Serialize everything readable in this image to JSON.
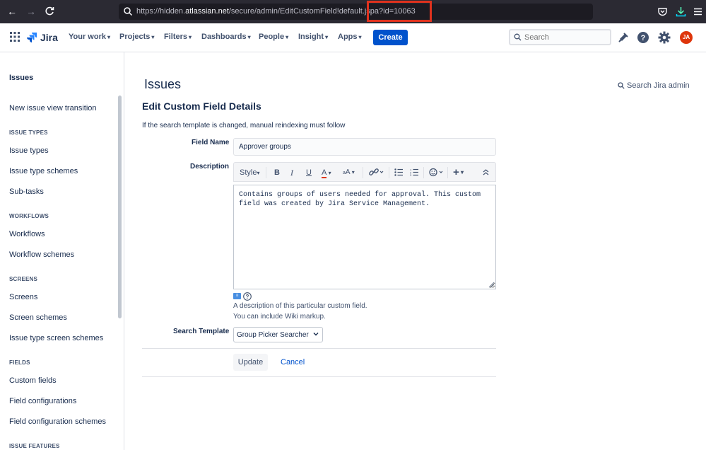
{
  "browser": {
    "url_prefix": "https://hidden.",
    "url_domain": "atlassian.net",
    "url_suffix": "/secure/admin/EditCustomField!default.jspa?id=10063"
  },
  "topnav": {
    "product": "Jira",
    "items": [
      {
        "label": "Your work"
      },
      {
        "label": "Projects"
      },
      {
        "label": "Filters"
      },
      {
        "label": "Dashboards"
      },
      {
        "label": "People"
      },
      {
        "label": "Insight"
      },
      {
        "label": "Apps"
      }
    ],
    "create_label": "Create",
    "search_placeholder": "Search",
    "avatar_initials": "JA"
  },
  "sidebar": {
    "heading": "Issues",
    "link_transition": "New issue view transition",
    "sections": [
      {
        "title": "ISSUE TYPES",
        "items": [
          "Issue types",
          "Issue type schemes",
          "Sub-tasks"
        ]
      },
      {
        "title": "WORKFLOWS",
        "items": [
          "Workflows",
          "Workflow schemes"
        ]
      },
      {
        "title": "SCREENS",
        "items": [
          "Screens",
          "Screen schemes",
          "Issue type screen schemes"
        ]
      },
      {
        "title": "FIELDS",
        "items": [
          "Custom fields",
          "Field configurations",
          "Field configuration schemes"
        ]
      },
      {
        "title": "ISSUE FEATURES",
        "items": []
      }
    ]
  },
  "main": {
    "page_title": "Issues",
    "admin_search": "Search Jira admin",
    "form_title": "Edit Custom Field Details",
    "note": "If the search template is changed, manual reindexing must follow",
    "field_name_label": "Field Name",
    "field_name_value": "Approver groups",
    "description_label": "Description",
    "toolbar": {
      "style": "Style"
    },
    "description_value": "Contains groups of users needed for approval. This custom field was created by Jira Service Management.",
    "desc_help_1": "A description of this particular custom field.",
    "desc_help_2": "You can include Wiki markup.",
    "search_template_label": "Search Template",
    "search_template_value": "Group Picker Searcher",
    "update_label": "Update",
    "cancel_label": "Cancel"
  },
  "colors": {
    "primary": "#0052cc",
    "highlight": "#e0321e",
    "avatar": "#de350b"
  }
}
